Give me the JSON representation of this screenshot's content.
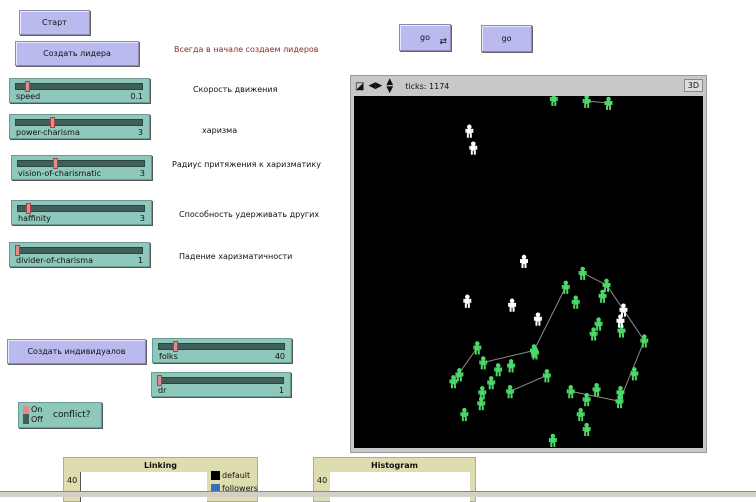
{
  "buttons": {
    "start": "Старт",
    "create_leader": "Создать лидера",
    "go_forever": "go",
    "go_once": "go",
    "create_individuals": "Создать индивидуалов"
  },
  "notes": {
    "leaders_first": "Всегда в начале создаем лидеров",
    "speed": "Скорость движения",
    "charisma": "харизма",
    "radius": "Радиус притяжения к харизматику",
    "retain": "Способность удерживать других",
    "drop": "Падение харизматичности"
  },
  "sliders": [
    {
      "name": "speed",
      "value": "0.1",
      "fraction": 0.08
    },
    {
      "name": "power-charisma",
      "value": "3",
      "fraction": 0.28
    },
    {
      "name": "vision-of-charismatic",
      "value": "3",
      "fraction": 0.29
    },
    {
      "name": "haffinity",
      "value": "3",
      "fraction": 0.07
    },
    {
      "name": "divider-of-charisma",
      "value": "1",
      "fraction": 0.0
    },
    {
      "name": "folks",
      "value": "40",
      "fraction": 0.12
    },
    {
      "name": "dr",
      "value": "1",
      "fraction": 0.0
    }
  ],
  "switch": {
    "on": "On",
    "off": "Off",
    "label": "conflict?"
  },
  "view": {
    "ticks_label": "ticks: 1174",
    "three_d": "3D"
  },
  "plots": {
    "linking": {
      "title": "Linking",
      "ymax": "40",
      "legend": [
        "default",
        "followers"
      ]
    },
    "histogram": {
      "title": "Histogram",
      "ymax": "40"
    }
  },
  "colors": {
    "leader": "#ffffff",
    "follower": "#4cd96a",
    "link": "#8a8a8a"
  }
}
